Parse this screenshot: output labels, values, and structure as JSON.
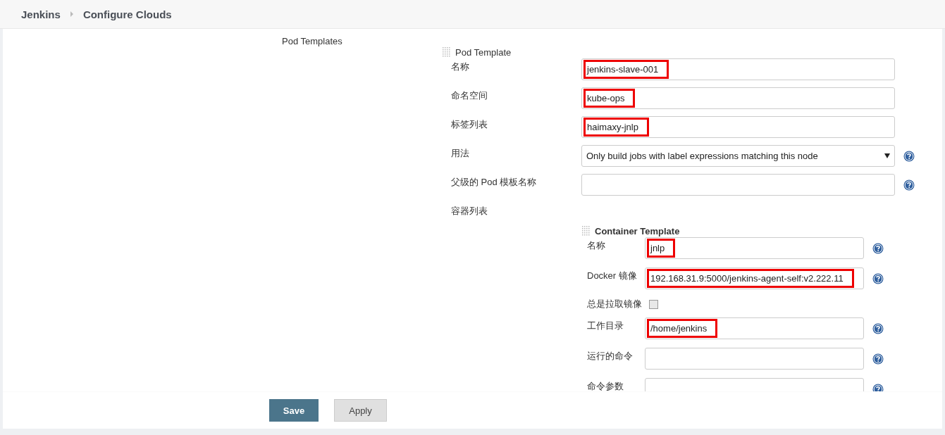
{
  "breadcrumbs": [
    {
      "label": "Jenkins"
    },
    {
      "label": "Configure Clouds"
    }
  ],
  "section_label": "Pod Templates",
  "pod_template": {
    "title": "Pod Template",
    "fields": [
      {
        "kind": "text",
        "label": "名称",
        "value": "jenkins-slave-001",
        "highlighted": true,
        "help": false
      },
      {
        "kind": "text",
        "label": "命名空间",
        "value": "kube-ops",
        "highlighted": true,
        "help": false
      },
      {
        "kind": "text",
        "label": "标签列表",
        "value": "haimaxy-jnlp",
        "highlighted": true,
        "help": false
      },
      {
        "kind": "select",
        "label": "用法",
        "value": "Only build jobs with label expressions matching this node",
        "highlighted": false,
        "help": true
      },
      {
        "kind": "text",
        "label": "父级的 Pod 模板名称",
        "highlighted": false,
        "help": true
      }
    ],
    "containers_label": "容器列表",
    "container_template": {
      "title": "Container Template",
      "fields": [
        {
          "kind": "text",
          "label": "名称",
          "value": "jnlp",
          "highlighted": true,
          "help": true
        },
        {
          "kind": "text",
          "label": "Docker 镜像",
          "value": "192.168.31.9:5000/jenkins-agent-self:v2.222.11",
          "highlighted": true,
          "help": true
        },
        {
          "kind": "checkbox",
          "label": "总是拉取镜像",
          "checked": false
        },
        {
          "kind": "text",
          "label": "工作目录",
          "value": "/home/jenkins",
          "highlighted": true,
          "help": true
        },
        {
          "kind": "text",
          "label": "运行的命令",
          "highlighted": false,
          "help": true
        },
        {
          "kind": "text",
          "label": "命令参数",
          "highlighted": false,
          "help": true
        }
      ]
    }
  },
  "buttons": [
    {
      "kind": "primary",
      "label": "Save"
    },
    {
      "kind": "secondary",
      "label": "Apply"
    }
  ]
}
